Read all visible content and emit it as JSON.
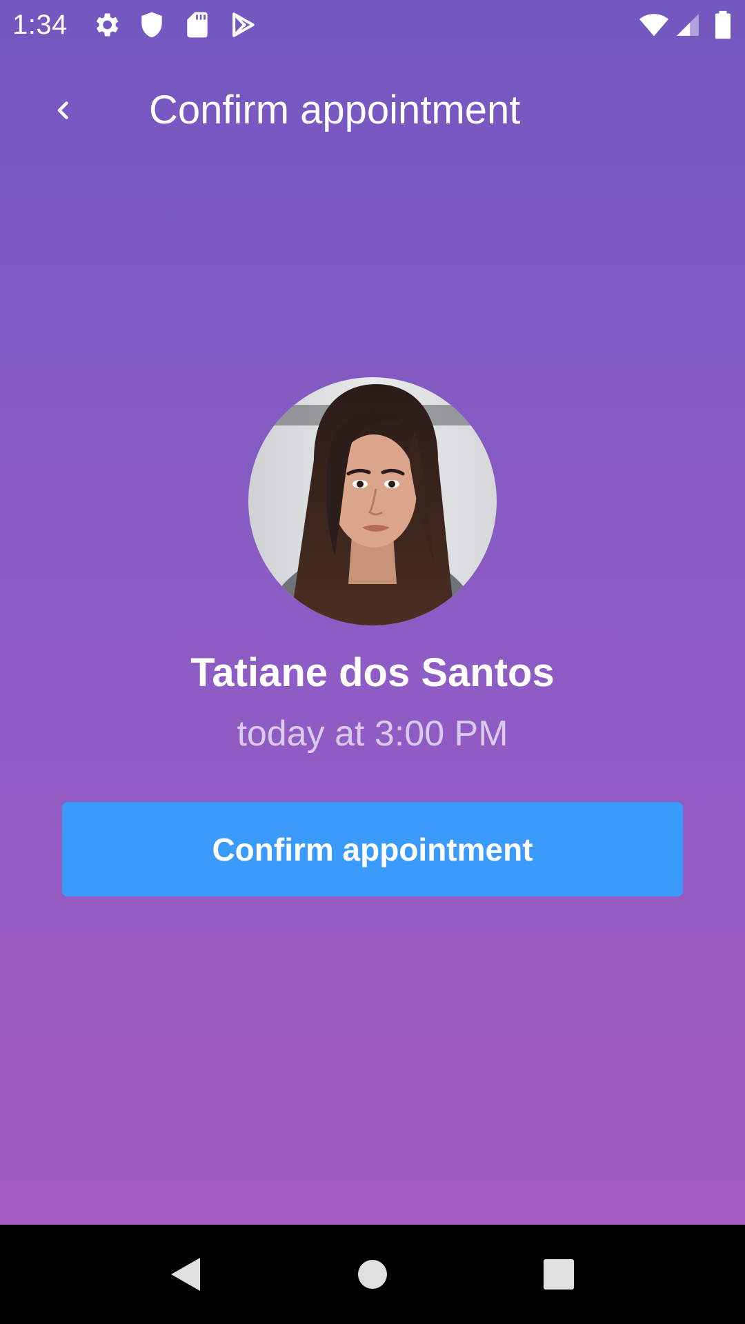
{
  "status_bar": {
    "time": "1:34",
    "left_icons": [
      "gear-icon",
      "shield-icon",
      "sd-card-icon",
      "play-store-icon"
    ],
    "right_icons": [
      "wifi-icon",
      "cell-signal-icon",
      "battery-icon"
    ]
  },
  "app_bar": {
    "back_icon": "chevron-left-icon",
    "title": "Confirm appointment"
  },
  "profile": {
    "avatar": "avatar-photo",
    "name": "Tatiane dos Santos",
    "when": "today at 3:00 PM"
  },
  "actions": {
    "confirm_label": "Confirm appointment"
  },
  "nav_bar": {
    "icons": [
      "back-triangle-icon",
      "home-circle-icon",
      "recents-square-icon"
    ]
  },
  "colors": {
    "gradient_top": "#7358C0",
    "gradient_bottom": "#A75CC2",
    "button": "#3A9BFC",
    "nav_bar": "#000000"
  }
}
